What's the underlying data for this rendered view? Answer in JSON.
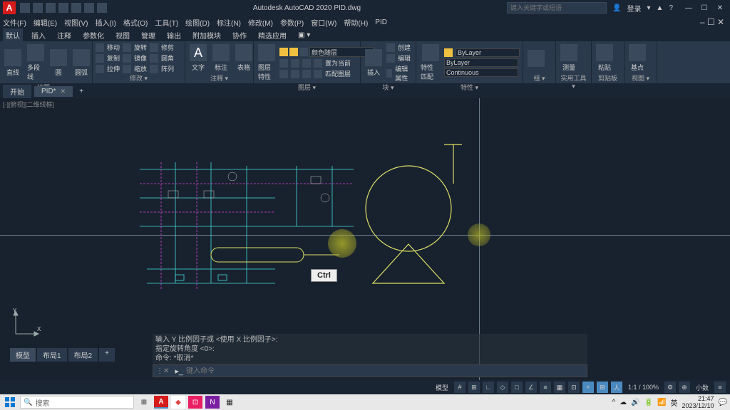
{
  "app": {
    "title": "Autodesk AutoCAD 2020   PID.dwg",
    "search_placeholder": "键入关键字或短语",
    "login": "登录"
  },
  "menu": [
    "文件(F)",
    "编辑(E)",
    "视图(V)",
    "插入(I)",
    "格式(O)",
    "工具(T)",
    "绘图(D)",
    "标注(N)",
    "修改(M)",
    "参数(P)",
    "窗口(W)",
    "帮助(H)",
    "PID"
  ],
  "ribbon_tabs": [
    "默认",
    "插入",
    "注释",
    "参数化",
    "视图",
    "管理",
    "输出",
    "附加模块",
    "协作",
    "精选应用"
  ],
  "ribbon": {
    "draw": {
      "label": "绘图 ▾",
      "line": "直线",
      "polyline": "多段线",
      "circle": "圆",
      "arc": "圆弧"
    },
    "modify": {
      "label": "修改 ▾",
      "move": "移动",
      "rotate": "旋转",
      "trim": "修剪",
      "copy": "复制",
      "mirror": "镜像",
      "fillet": "圆角",
      "stretch": "拉伸",
      "scale": "缩放",
      "array": "阵列"
    },
    "annot": {
      "label": "注释 ▾",
      "text": "文字",
      "dim": "标注",
      "table": "表格"
    },
    "layers": {
      "label": "图层 ▾",
      "btn": "图层\n特性",
      "row": "颜色随层"
    },
    "block": {
      "label": "块 ▾",
      "insert": "插入",
      "create": "创建",
      "edit": "编辑",
      "attrib": "编辑属性"
    },
    "props": {
      "label": "特性 ▾",
      "btn": "特性\n匹配",
      "bylayer": "ByLayer",
      "continuous": "Continuous"
    },
    "groups": {
      "label": "组 ▾"
    },
    "utils": {
      "label": "实用工具 ▾",
      "measure": "测量"
    },
    "clip": {
      "label": "剪贴板",
      "paste": "粘贴"
    },
    "base": {
      "label": "视图 ▾",
      "btn": "基点"
    }
  },
  "file_tabs": {
    "start": "开始",
    "current": "PID*"
  },
  "viewport_label": "[-][俯视][二维线框]",
  "ctrl_badge": "Ctrl",
  "ucs": {
    "x": "X",
    "y": "Y"
  },
  "cmd": {
    "h1": "输入 Y 比例因子或 <使用 X 比例因子>:",
    "h2": "指定旋转角度 <0>:",
    "h3": "命令: *取消*",
    "placeholder": "键入命令"
  },
  "model_tabs": [
    "模型",
    "布局1",
    "布局2"
  ],
  "status": {
    "model": "模型",
    "zoom": "1:1 / 100%",
    "person": "小数"
  },
  "taskbar": {
    "search": "搜索",
    "ime": "英",
    "time": "21:47",
    "date": "2023/12/10"
  }
}
